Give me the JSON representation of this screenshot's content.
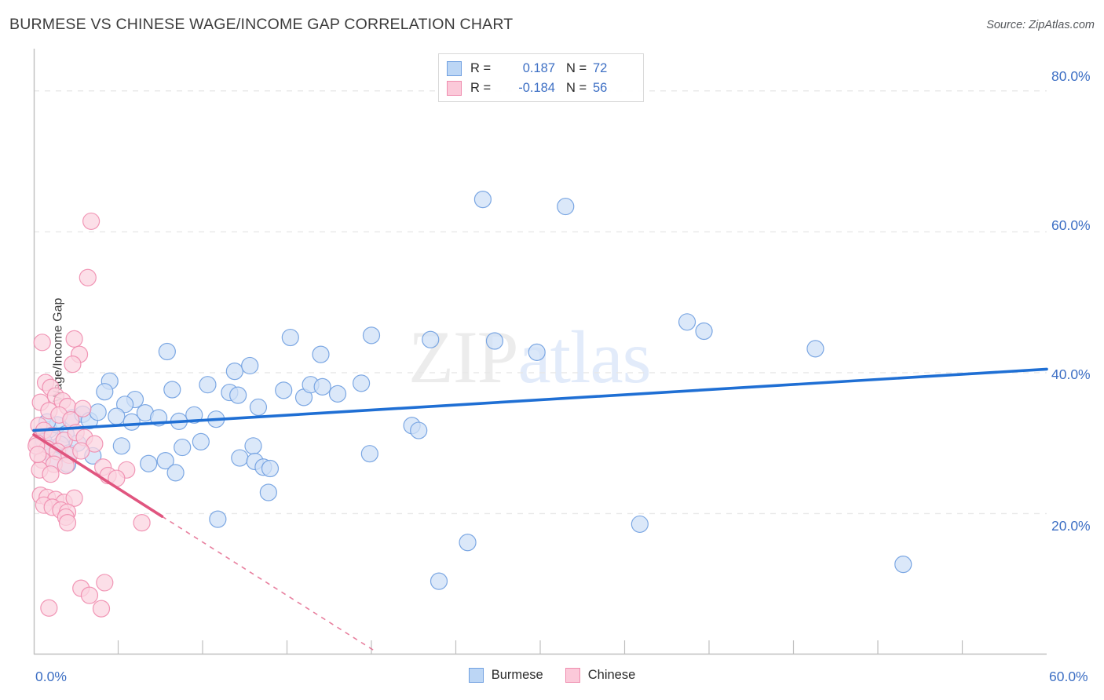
{
  "header": {
    "title": "BURMESE VS CHINESE WAGE/INCOME GAP CORRELATION CHART",
    "source": "Source: ZipAtlas.com"
  },
  "watermark": {
    "part1": "ZIP",
    "part2": "atlas"
  },
  "axes": {
    "ylabel": "Wage/Income Gap",
    "y_ticks": [
      "80.0%",
      "60.0%",
      "40.0%",
      "20.0%"
    ],
    "x_min_label": "0.0%",
    "x_max_label": "60.0%"
  },
  "stats": {
    "rows": [
      {
        "series": "Burmese",
        "r_key": "R =",
        "r_value": "0.187",
        "n_key": "N =",
        "n_value": "72",
        "color": "#bcd6f5"
      },
      {
        "series": "Chinese",
        "r_key": "R =",
        "r_value": "-0.184",
        "n_key": "N =",
        "n_value": "56",
        "color": "#fbc9d9"
      }
    ]
  },
  "legend": {
    "items": [
      {
        "label": "Burmese",
        "color": "#bcd6f5",
        "border": "#6f9fe0"
      },
      {
        "label": "Chinese",
        "color": "#fbc9d9",
        "border": "#ef8cae"
      }
    ]
  },
  "colors": {
    "blue_fill": "#cfe0f7",
    "blue_stroke": "#6f9fe0",
    "pink_fill": "#fbd4e0",
    "pink_stroke": "#ef8cae",
    "blue_line": "#1f6fd4",
    "pink_line": "#e0557f",
    "grid": "#e8e8e8",
    "axis": "#bfbfbf",
    "tick_text": "#3d6fc4"
  },
  "chart_data": {
    "type": "scatter",
    "title": "BURMESE VS CHINESE WAGE/INCOME GAP CORRELATION CHART",
    "xlabel": "",
    "ylabel": "Wage/Income Gap",
    "xlim": [
      0.0,
      60.0
    ],
    "ylim": [
      0.0,
      86.0
    ],
    "x_tick_labels": [
      "0.0%",
      "60.0%"
    ],
    "y_tick_labels": [
      "20.0%",
      "40.0%",
      "60.0%",
      "80.0%"
    ],
    "y_ticks": [
      20.0,
      40.0,
      60.0,
      80.0
    ],
    "grid": "horizontal-dashed",
    "legend_position": "bottom-center",
    "series": [
      {
        "name": "Burmese",
        "color": "#cfe0f7",
        "stroke": "#6f9fe0",
        "r": 0.187,
        "n": 72,
        "trendline": {
          "style": "solid",
          "color": "#1f6fd4",
          "x0": 0.0,
          "y0": 31.8,
          "x1": 60.0,
          "y1": 40.5
        },
        "points": [
          [
            26.6,
            64.6
          ],
          [
            31.5,
            63.6
          ],
          [
            38.7,
            47.2
          ],
          [
            39.7,
            45.9
          ],
          [
            46.3,
            43.4
          ],
          [
            15.2,
            45.0
          ],
          [
            20.0,
            45.3
          ],
          [
            23.5,
            44.7
          ],
          [
            27.3,
            44.5
          ],
          [
            29.8,
            42.9
          ],
          [
            7.9,
            43.0
          ],
          [
            11.9,
            40.2
          ],
          [
            12.8,
            41.0
          ],
          [
            17.0,
            42.6
          ],
          [
            4.5,
            38.8
          ],
          [
            4.2,
            37.3
          ],
          [
            8.2,
            37.6
          ],
          [
            6.0,
            36.2
          ],
          [
            5.4,
            35.5
          ],
          [
            10.3,
            38.3
          ],
          [
            11.6,
            37.2
          ],
          [
            12.1,
            36.8
          ],
          [
            13.3,
            35.1
          ],
          [
            14.8,
            37.5
          ],
          [
            16.0,
            36.5
          ],
          [
            16.4,
            38.3
          ],
          [
            17.1,
            38.0
          ],
          [
            19.4,
            38.5
          ],
          [
            18.0,
            37.0
          ],
          [
            2.3,
            33.6
          ],
          [
            2.9,
            34.1
          ],
          [
            3.3,
            33.2
          ],
          [
            3.8,
            34.4
          ],
          [
            4.9,
            33.8
          ],
          [
            5.8,
            33.0
          ],
          [
            6.6,
            34.3
          ],
          [
            7.4,
            33.6
          ],
          [
            8.6,
            33.1
          ],
          [
            9.5,
            34.0
          ],
          [
            10.8,
            33.4
          ],
          [
            0.9,
            31.9
          ],
          [
            1.4,
            32.6
          ],
          [
            1.9,
            31.3
          ],
          [
            0.6,
            30.2
          ],
          [
            1.1,
            29.3
          ],
          [
            1.6,
            29.8
          ],
          [
            2.1,
            28.6
          ],
          [
            2.6,
            30.0
          ],
          [
            5.2,
            29.6
          ],
          [
            8.8,
            29.4
          ],
          [
            9.9,
            30.2
          ],
          [
            13.0,
            29.6
          ],
          [
            12.2,
            27.9
          ],
          [
            13.1,
            27.4
          ],
          [
            13.6,
            26.6
          ],
          [
            14.0,
            26.4
          ],
          [
            6.8,
            27.1
          ],
          [
            7.8,
            27.5
          ],
          [
            8.4,
            25.8
          ],
          [
            19.9,
            28.5
          ],
          [
            22.4,
            32.5
          ],
          [
            22.8,
            31.8
          ],
          [
            13.9,
            23.0
          ],
          [
            25.7,
            15.9
          ],
          [
            24.0,
            10.4
          ],
          [
            35.9,
            18.5
          ],
          [
            51.5,
            12.8
          ],
          [
            10.9,
            19.2
          ],
          [
            3.5,
            28.2
          ],
          [
            2.0,
            27.0
          ],
          [
            1.2,
            27.6
          ],
          [
            0.8,
            33.0
          ]
        ]
      },
      {
        "name": "Chinese",
        "color": "#fbd4e0",
        "stroke": "#ef8cae",
        "r": -0.184,
        "n": 56,
        "trendline": {
          "style": "solid-then-dashed",
          "color": "#e0557f",
          "x0": 0.0,
          "y0": 31.2,
          "x1": 7.6,
          "y1": 19.6,
          "x_dash_end": 20.2,
          "y_dash_end": 0.5
        },
        "points": [
          [
            3.4,
            61.5
          ],
          [
            3.2,
            53.5
          ],
          [
            0.5,
            44.3
          ],
          [
            2.4,
            44.8
          ],
          [
            2.7,
            42.6
          ],
          [
            2.3,
            41.2
          ],
          [
            0.7,
            38.6
          ],
          [
            1.0,
            37.9
          ],
          [
            1.3,
            36.7
          ],
          [
            1.7,
            36.0
          ],
          [
            2.0,
            35.2
          ],
          [
            0.4,
            35.8
          ],
          [
            0.9,
            34.6
          ],
          [
            1.5,
            34.0
          ],
          [
            2.2,
            33.3
          ],
          [
            2.9,
            34.9
          ],
          [
            0.3,
            32.5
          ],
          [
            0.6,
            31.8
          ],
          [
            1.1,
            31.1
          ],
          [
            1.8,
            30.4
          ],
          [
            2.5,
            31.5
          ],
          [
            3.0,
            30.8
          ],
          [
            3.6,
            29.9
          ],
          [
            0.2,
            30.0
          ],
          [
            0.8,
            29.2
          ],
          [
            1.4,
            28.8
          ],
          [
            2.1,
            28.3
          ],
          [
            2.8,
            28.9
          ],
          [
            0.5,
            27.6
          ],
          [
            1.2,
            27.0
          ],
          [
            1.9,
            26.8
          ],
          [
            0.35,
            26.2
          ],
          [
            1.0,
            25.6
          ],
          [
            0.15,
            29.6
          ],
          [
            0.25,
            28.4
          ],
          [
            4.1,
            26.6
          ],
          [
            5.5,
            26.2
          ],
          [
            4.4,
            25.4
          ],
          [
            4.9,
            25.0
          ],
          [
            0.4,
            22.6
          ],
          [
            0.8,
            22.3
          ],
          [
            1.3,
            22.0
          ],
          [
            1.8,
            21.6
          ],
          [
            2.4,
            22.2
          ],
          [
            0.6,
            21.2
          ],
          [
            1.1,
            20.9
          ],
          [
            1.6,
            20.5
          ],
          [
            2.0,
            20.2
          ],
          [
            1.9,
            19.5
          ],
          [
            2.0,
            18.7
          ],
          [
            6.4,
            18.7
          ],
          [
            2.8,
            9.4
          ],
          [
            4.2,
            10.2
          ],
          [
            3.3,
            8.4
          ],
          [
            0.9,
            6.6
          ],
          [
            4.0,
            6.5
          ]
        ]
      }
    ]
  }
}
